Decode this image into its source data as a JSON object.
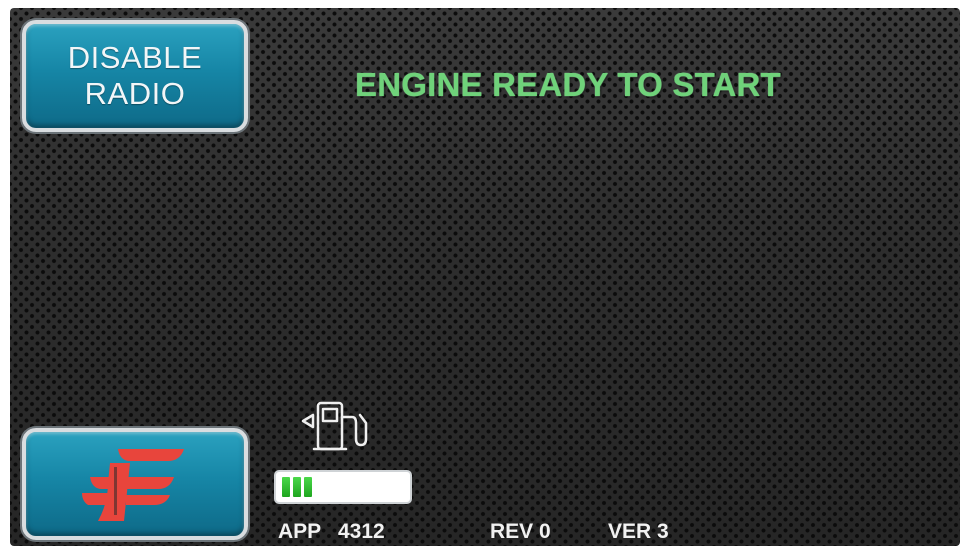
{
  "buttons": {
    "disable_radio": {
      "line1": "DISABLE",
      "line2": "RADIO"
    },
    "brand_logo": {
      "icon": "brand-f-logo-icon"
    }
  },
  "status": {
    "message": "ENGINE READY TO START",
    "color": "#6fd27a"
  },
  "fuel": {
    "icon": "fuel-pump-icon",
    "level_fraction": 0.3,
    "fill_color": "#2fbf2f"
  },
  "footer": {
    "app_label": "APP",
    "app_value": "4312",
    "rev": "REV 0",
    "ver": "VER 3"
  },
  "colors": {
    "button_teal": "#1686a6",
    "background": "#2a2a2a",
    "logo_red": "#e8453c"
  }
}
